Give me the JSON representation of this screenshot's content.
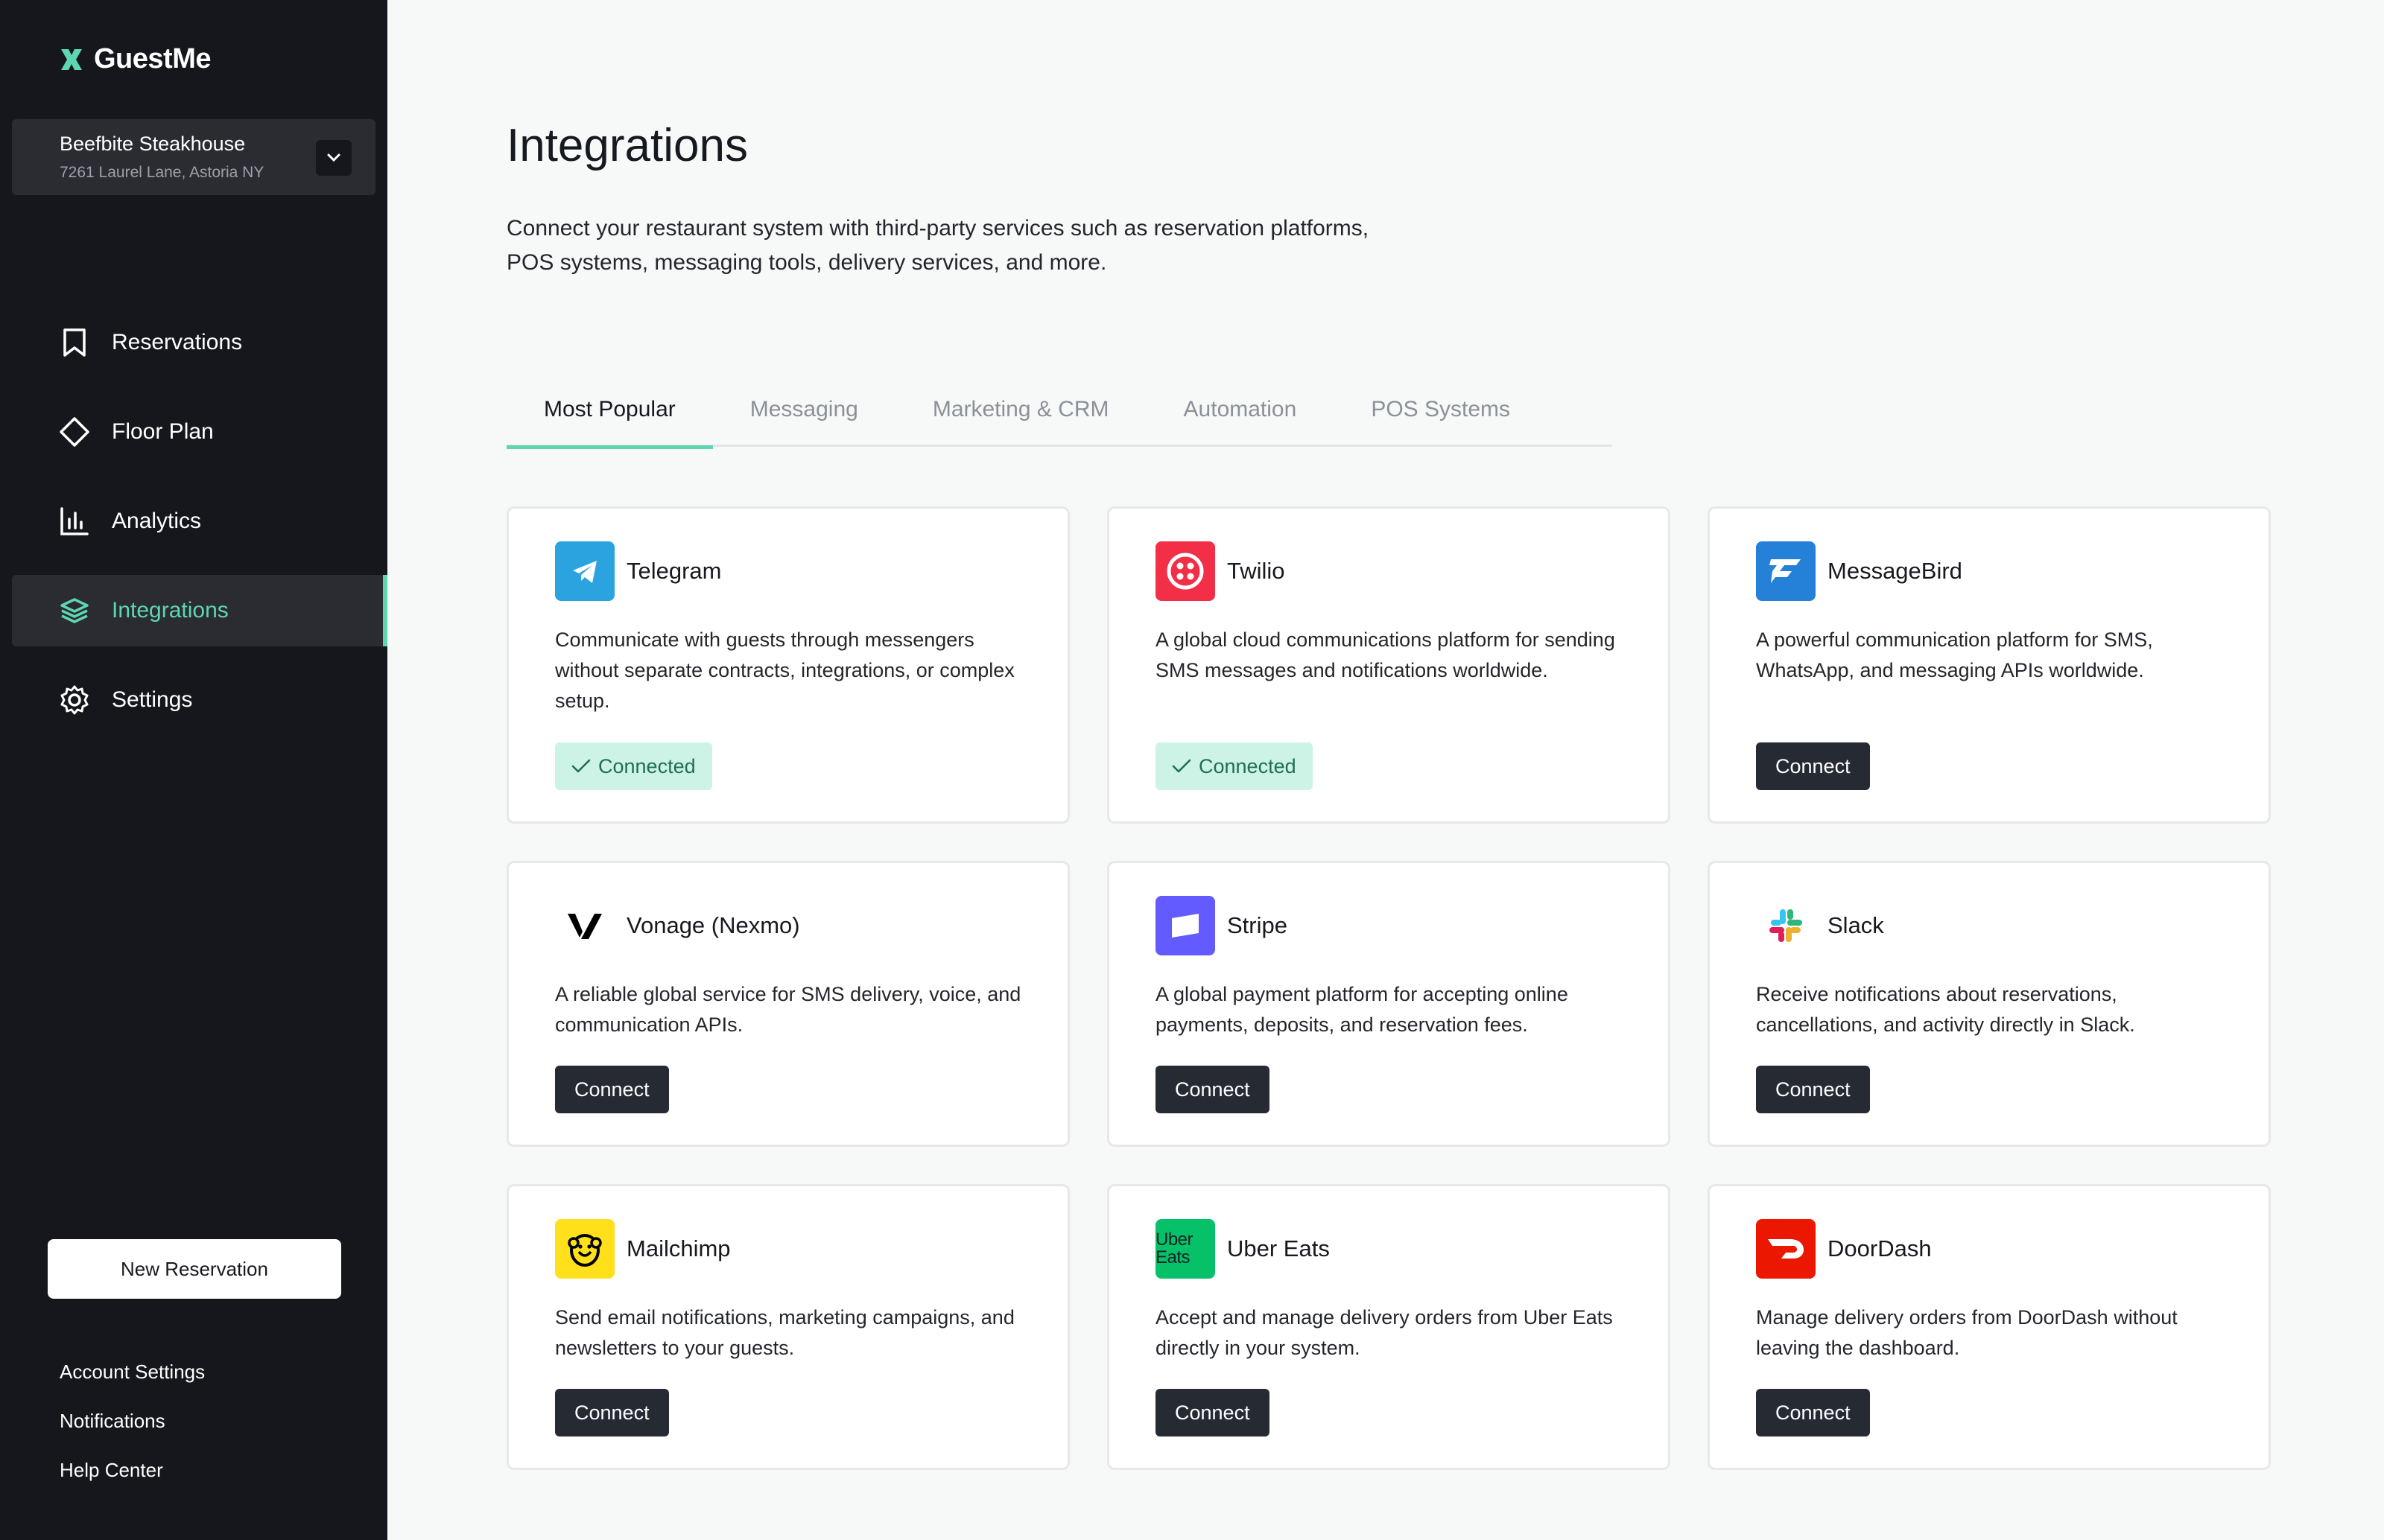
{
  "app": {
    "name": "GuestMe"
  },
  "venue": {
    "name": "Beefbite Steakhouse",
    "address": "7261 Laurel Lane, Astoria NY"
  },
  "nav": [
    {
      "label": "Reservations",
      "icon": "bookmark-icon",
      "active": false
    },
    {
      "label": "Floor Plan",
      "icon": "floor-plan-icon",
      "active": false
    },
    {
      "label": "Analytics",
      "icon": "chart-icon",
      "active": false
    },
    {
      "label": "Integrations",
      "icon": "layers-icon",
      "active": true
    },
    {
      "label": "Settings",
      "icon": "gear-icon",
      "active": false
    }
  ],
  "new_reservation_label": "New Reservation",
  "bottom_links": [
    "Account Settings",
    "Notifications",
    "Help Center"
  ],
  "page": {
    "title": "Integrations",
    "description_line1": "Connect your restaurant system with third-party services such as reservation platforms,",
    "description_line2": "POS systems, messaging tools, delivery services, and more."
  },
  "tabs": [
    "Most Popular",
    "Messaging",
    "Marketing & CRM",
    "Automation",
    "POS Systems"
  ],
  "active_tab": "Most Popular",
  "colors": {
    "accent": "#5ed6b0",
    "sidebar": "#16171c",
    "button": "#262a33"
  },
  "integrations": [
    {
      "name": "Telegram",
      "icon": "telegram-icon",
      "brand_color": "#2aa3df",
      "description": "Communicate with guests through messengers without separate contracts, integrations, or complex setup.",
      "status": "Connected"
    },
    {
      "name": "Twilio",
      "icon": "twilio-icon",
      "brand_color": "#f22f46",
      "description": "A global cloud communications platform for sending SMS messages and notifications worldwide.",
      "status": "Connected"
    },
    {
      "name": "MessageBird",
      "icon": "messagebird-icon",
      "brand_color": "#2481d7",
      "description": "A powerful communication platform for SMS, WhatsApp, and messaging APIs worldwide.",
      "status": "Connect"
    },
    {
      "name": "Vonage (Nexmo)",
      "icon": "vonage-icon",
      "brand_color": "#000000",
      "description": "A reliable global service for SMS delivery, voice, and communication APIs.",
      "status": "Connect"
    },
    {
      "name": "Stripe",
      "icon": "stripe-icon",
      "brand_color": "#635bff",
      "description": "A global payment platform for accepting online payments, deposits, and reservation fees.",
      "status": "Connect"
    },
    {
      "name": "Slack",
      "icon": "slack-icon",
      "brand_color": "#4a154b",
      "description": "Receive notifications about reservations, cancellations, and activity directly in Slack.",
      "status": "Connect"
    },
    {
      "name": "Mailchimp",
      "icon": "mailchimp-icon",
      "brand_color": "#ffe01b",
      "description": "Send email notifications, marketing campaigns, and newsletters to your guests.",
      "status": "Connect"
    },
    {
      "name": "Uber Eats",
      "icon": "uber-eats-icon",
      "brand_color": "#06c167",
      "brand_text": "Uber Eats",
      "description": "Accept and manage delivery orders from Uber Eats directly in your system.",
      "status": "Connect"
    },
    {
      "name": "DoorDash",
      "icon": "doordash-icon",
      "brand_color": "#eb1700",
      "description": "Manage delivery orders from DoorDash without leaving the dashboard.",
      "status": "Connect"
    }
  ]
}
